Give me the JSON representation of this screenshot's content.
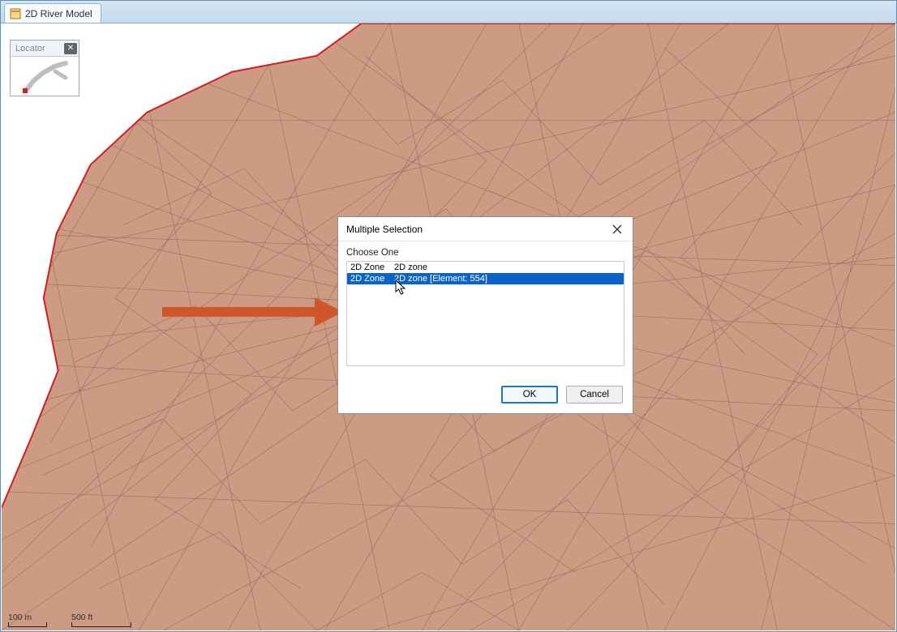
{
  "tab": {
    "title": "2D River Model"
  },
  "locator": {
    "title": "Locator"
  },
  "rulers": {
    "metric": "100 m",
    "imperial": "500 ft"
  },
  "dialog": {
    "title": "Multiple Selection",
    "label": "Choose One",
    "rows": [
      {
        "col1": "2D Zone",
        "col2": "2D zone",
        "selected": false
      },
      {
        "col1": "2D Zone",
        "col2": "2D zone [Element: 554]",
        "selected": true
      }
    ],
    "ok": "OK",
    "cancel": "Cancel"
  }
}
